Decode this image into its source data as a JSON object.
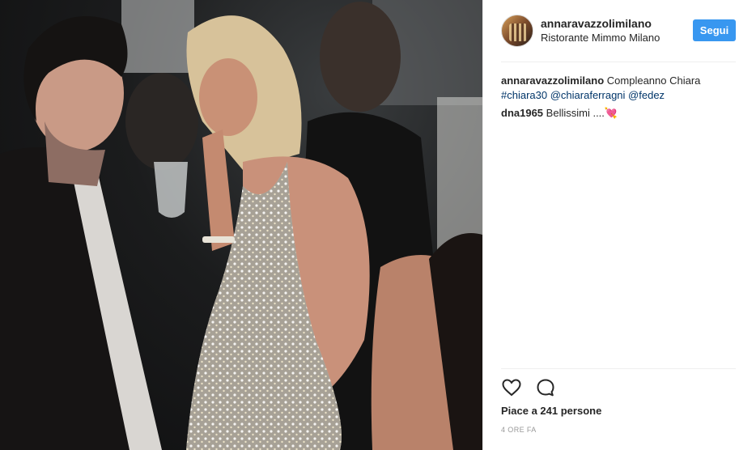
{
  "post": {
    "header": {
      "username": "annaravazzolimilano",
      "location": "Ristorante Mimmo Milano",
      "follow_label": "Segui"
    },
    "comments": [
      {
        "user": "annaravazzolimilano",
        "text": "Compleanno Chiara",
        "tags": [
          "#chiara30",
          "@chiaraferragni",
          "@fedez"
        ]
      },
      {
        "user": "dna1965",
        "text": "Bellissimi ....💘"
      }
    ],
    "actions": {
      "like_icon": "heart-icon",
      "comment_icon": "comment-bubble-icon"
    },
    "likes_text": "Piace a 241 persone",
    "timestamp": "4 ORE FA",
    "colors": {
      "follow_button": "#3897f0",
      "tag_link": "#003569"
    }
  }
}
